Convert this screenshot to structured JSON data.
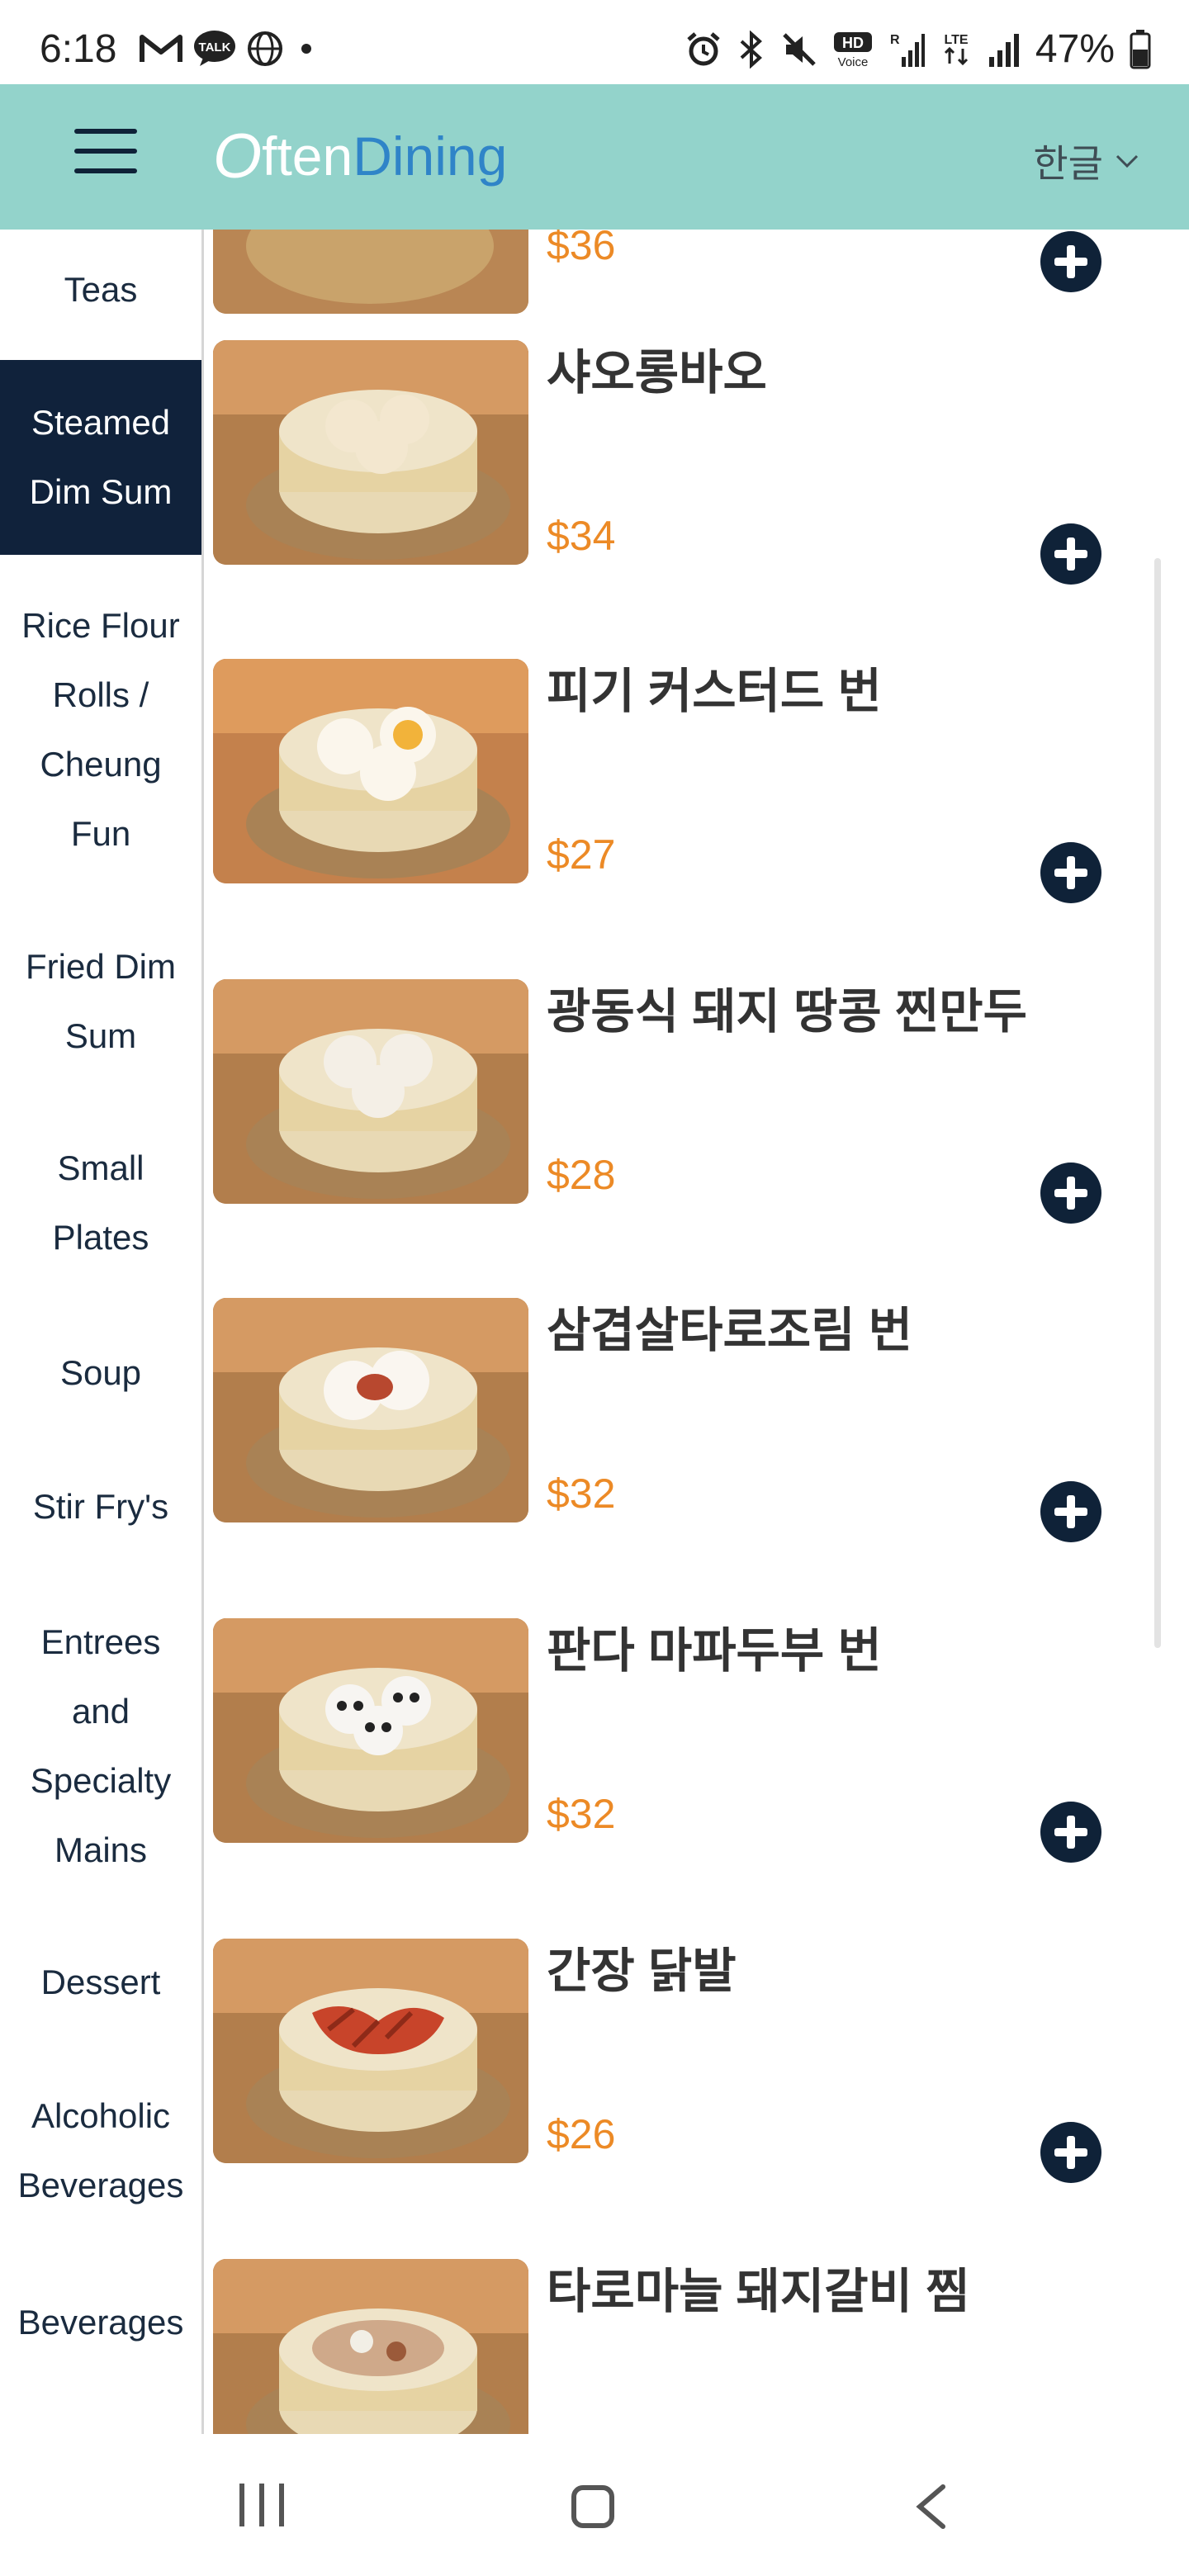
{
  "status": {
    "time": "6:18",
    "battery": "47%",
    "hd_label": "HD",
    "voice_label": "Voice",
    "lte_label": "LTE",
    "r_label": "R",
    "talk_label": "TALK"
  },
  "header": {
    "logo_o": "O",
    "logo_often": "ften",
    "logo_dining": "Dining",
    "language": "한글"
  },
  "sidebar": {
    "categories": [
      {
        "label": "Teas",
        "active": false
      },
      {
        "label": "Steamed Dim Sum",
        "active": true
      },
      {
        "label": "Rice Flour Rolls / Cheung Fun",
        "active": false
      },
      {
        "label": "Fried Dim Sum",
        "active": false
      },
      {
        "label": "Small Plates",
        "active": false
      },
      {
        "label": "Soup",
        "active": false
      },
      {
        "label": "Stir Fry's",
        "active": false
      },
      {
        "label": "Entrees and Specialty Mains",
        "active": false
      },
      {
        "label": "Dessert",
        "active": false
      },
      {
        "label": "Alcoholic Beverages",
        "active": false
      },
      {
        "label": "Beverages",
        "active": false
      }
    ]
  },
  "menu": {
    "partial_top_price": "$36",
    "items": [
      {
        "name": "샤오롱바오",
        "price": "$34",
        "filling": "#f3e7cf"
      },
      {
        "name": "피기 커스터드 번",
        "price": "$27",
        "filling": "#f2b33a"
      },
      {
        "name": "광동식 돼지 땅콩 찐만두",
        "price": "$28",
        "filling": "#f4efe6"
      },
      {
        "name": "삼겹살타로조림 번",
        "price": "$32",
        "filling": "#b8482f"
      },
      {
        "name": "판다 마파두부 번",
        "price": "$32",
        "filling": "#f7f5f2"
      },
      {
        "name": "간장 닭발",
        "price": "$26",
        "filling": "#c8442a"
      },
      {
        "name": "타로마늘 돼지갈비 찜",
        "price": "",
        "filling": "#cfa98a"
      }
    ]
  },
  "colors": {
    "header_bg": "#93d3cb",
    "sidebar_active": "#10223b",
    "price": "#ec8a26",
    "add_button": "#0f2238"
  }
}
